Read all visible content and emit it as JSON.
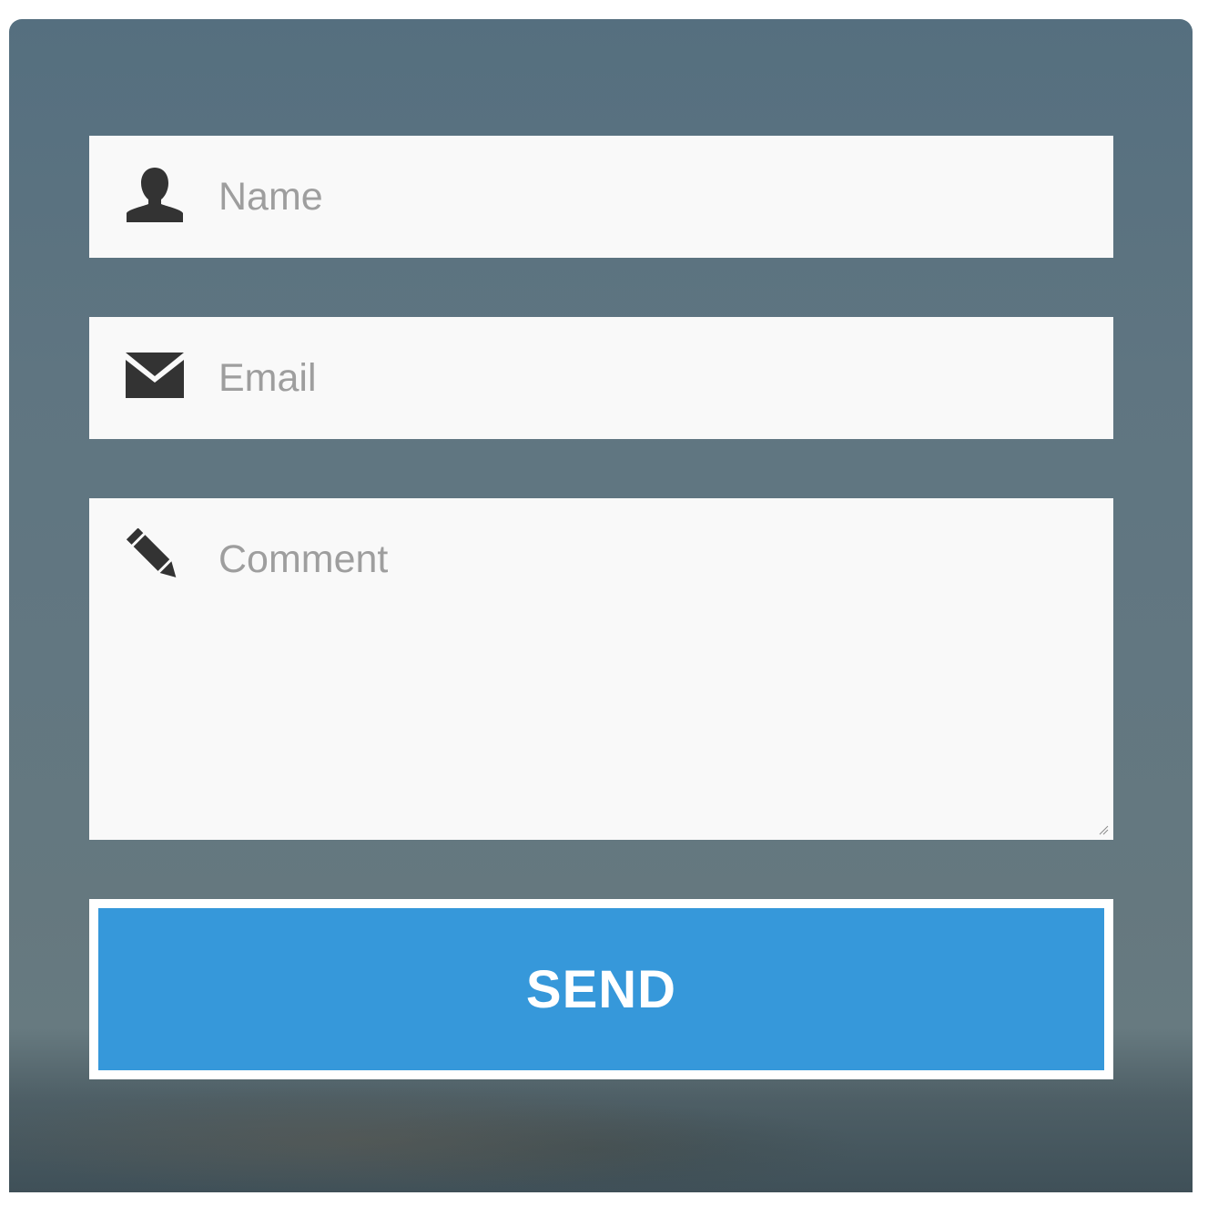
{
  "form": {
    "name_field": {
      "placeholder": "Name",
      "value": ""
    },
    "email_field": {
      "placeholder": "Email",
      "value": ""
    },
    "comment_field": {
      "placeholder": "Comment",
      "value": ""
    },
    "send_label": "SEND"
  },
  "icons": {
    "name": "user-icon",
    "email": "envelope-icon",
    "comment": "pencil-icon"
  },
  "colors": {
    "panel_background": "#5f7581",
    "field_background": "#f9f9f9",
    "placeholder_text": "#9e9e9e",
    "icon": "#333333",
    "send_button": "#3698da",
    "send_text": "#ffffff"
  }
}
